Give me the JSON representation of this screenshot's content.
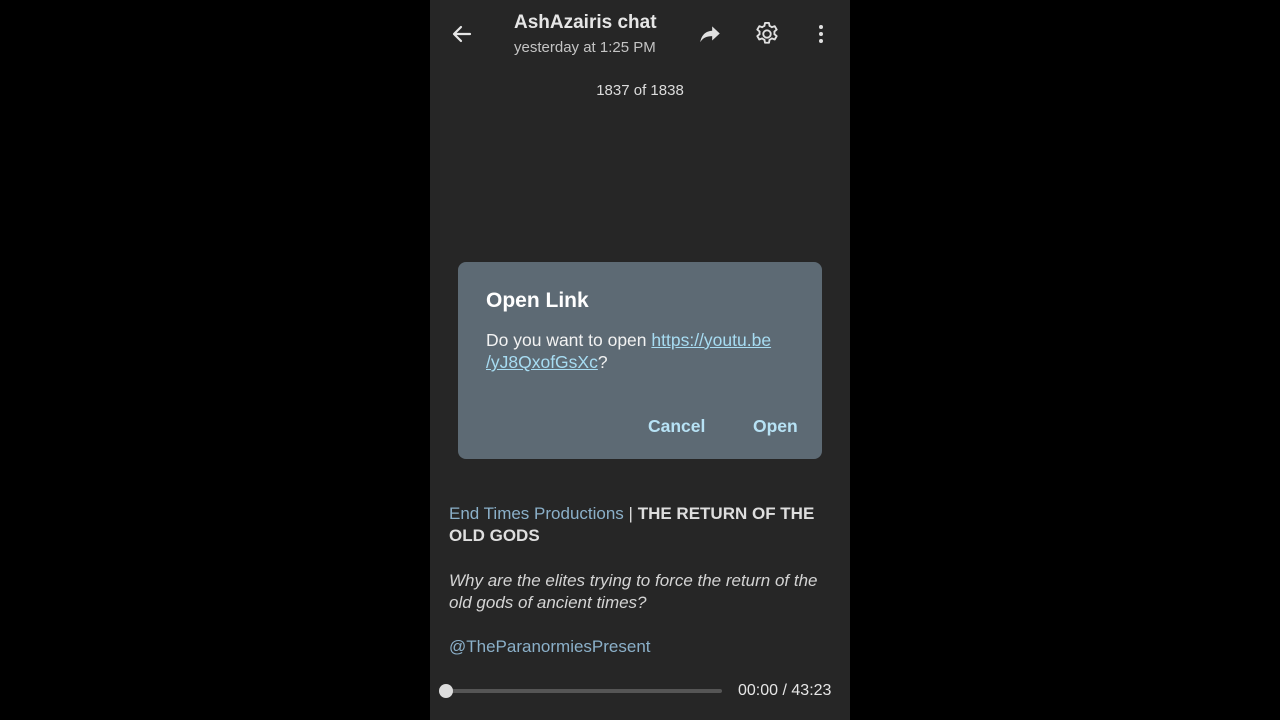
{
  "header": {
    "title": "AshAzairis chat",
    "subtitle": "yesterday at 1:25 PM",
    "icons": {
      "back": "arrow-left-icon",
      "share": "share-forward-icon",
      "settings": "gear-icon",
      "more": "more-vertical-icon"
    }
  },
  "counter": {
    "current": "1837",
    "of": "of",
    "total": "1838"
  },
  "dialog": {
    "title": "Open Link",
    "prompt": "Do you want to open ",
    "link_line1": "https://youtu.be",
    "link_line2": "/yJ8QxofGsXc",
    "suffix": "?",
    "cancel_label": "Cancel",
    "open_label": "Open"
  },
  "caption": {
    "channel": "End Times Productions",
    "separator": " | ",
    "title": "THE RETURN OF THE OLD GODS",
    "description": "Why are the elites trying to force the return of the old gods of ancient times?",
    "mention": "@TheParanormiesPresent"
  },
  "player": {
    "progress": 0,
    "current_time": "00:00",
    "time_separator": " / ",
    "duration": "43:23"
  },
  "colors": {
    "background": "#262626",
    "dialog": "#5d6a74",
    "link": "#a7dcf2",
    "accent": "#8bb0c9"
  }
}
